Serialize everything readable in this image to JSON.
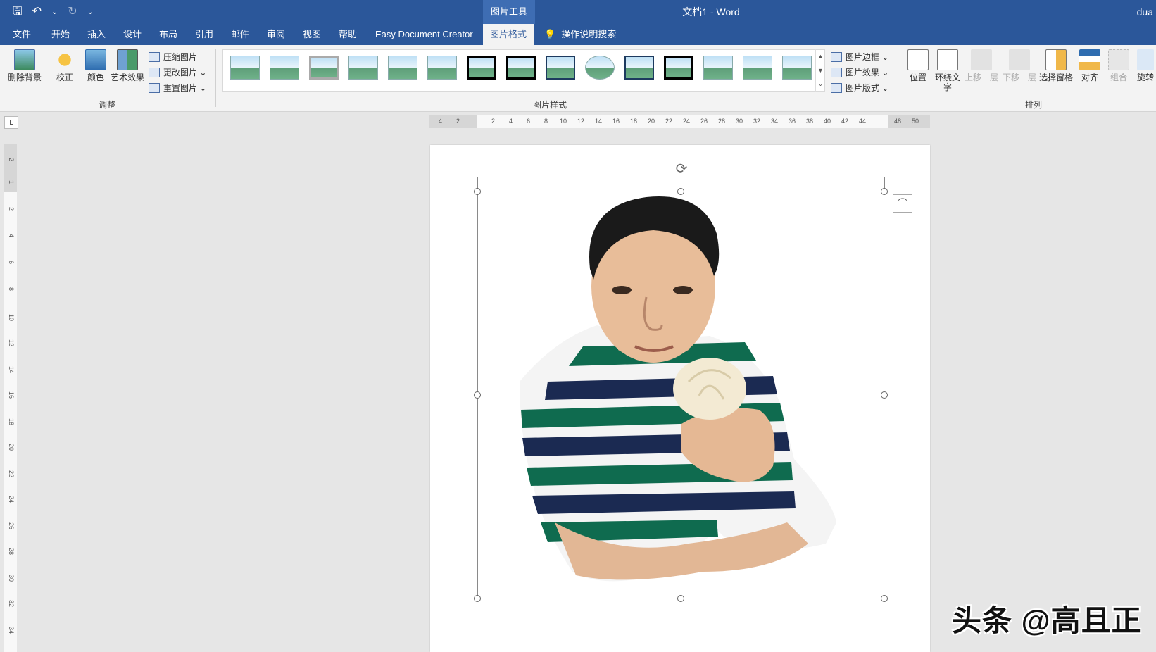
{
  "titlebar": {
    "context_tab": "图片工具",
    "doc_title": "文档1  -  Word",
    "user": "dua",
    "qat": {
      "save": "🖫",
      "undo": "↶",
      "undo_menu": "⌄",
      "redo": "↻",
      "customize": "⌄"
    }
  },
  "menu": {
    "tabs": [
      "文件",
      "开始",
      "插入",
      "设计",
      "布局",
      "引用",
      "邮件",
      "审阅",
      "视图",
      "帮助",
      "Easy Document Creator",
      "图片格式"
    ],
    "tell_me_icon": "💡",
    "tell_me": "操作说明搜索"
  },
  "ribbon": {
    "adjust": {
      "remove_bg": "删除背景",
      "correct": "校正",
      "color": "颜色",
      "artistic": "艺术效果",
      "compress": "压缩图片",
      "change": "更改图片 ⌄",
      "reset": "重置图片 ⌄",
      "group": "调整"
    },
    "styles": {
      "border": "图片边框 ⌄",
      "effects": "图片效果 ⌄",
      "layout": "图片版式 ⌄",
      "group": "图片样式",
      "scroll_up": "▲",
      "scroll_down": "▼",
      "more": "⌄"
    },
    "arrange": {
      "position": "位置",
      "wrap_text": "环绕文字",
      "bring_forward": "上移一层",
      "send_backward": "下移一层",
      "selection_pane": "选择窗格",
      "align": "对齐",
      "group_btn": "组合",
      "rotate": "旋转",
      "group": "排列"
    }
  },
  "ruler": {
    "corner": "L",
    "h_numbers": [
      "4",
      "2",
      "2",
      "4",
      "6",
      "8",
      "10",
      "12",
      "14",
      "16",
      "18",
      "20",
      "22",
      "24",
      "26",
      "28",
      "30",
      "32",
      "34",
      "36",
      "38",
      "40",
      "42",
      "44",
      "48",
      "50"
    ],
    "v_numbers": [
      "2",
      "1",
      "2",
      "4",
      "6",
      "8",
      "10",
      "12",
      "14",
      "16",
      "18",
      "20",
      "22",
      "24",
      "26",
      "28",
      "30",
      "32",
      "34"
    ]
  },
  "canvas": {
    "rotate_icon": "⟳",
    "layout_icon": "⌒"
  },
  "watermark": "头条 @高且正"
}
